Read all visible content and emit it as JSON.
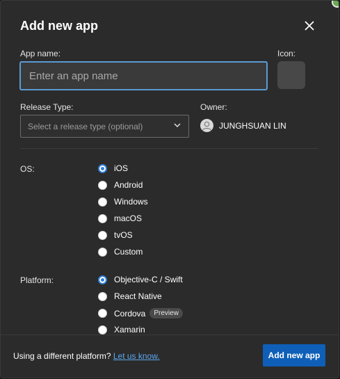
{
  "dialog": {
    "title": "Add new app",
    "close_icon": "close-icon"
  },
  "app_name": {
    "label": "App name:",
    "placeholder": "Enter an app name",
    "value": ""
  },
  "icon": {
    "label": "Icon:"
  },
  "release_type": {
    "label": "Release Type:",
    "placeholder": "Select a release type (optional)",
    "chevron_icon": "chevron-down-icon"
  },
  "owner": {
    "label": "Owner:",
    "name": "JUNGHSUAN LIN",
    "avatar_icon": "user-avatar-icon"
  },
  "os": {
    "label": "OS:",
    "options": [
      {
        "label": "iOS",
        "selected": true
      },
      {
        "label": "Android",
        "selected": false
      },
      {
        "label": "Windows",
        "selected": false
      },
      {
        "label": "macOS",
        "selected": false
      },
      {
        "label": "tvOS",
        "selected": false
      },
      {
        "label": "Custom",
        "selected": false
      }
    ]
  },
  "platform": {
    "label": "Platform:",
    "options": [
      {
        "label": "Objective-C / Swift",
        "selected": true,
        "badge": ""
      },
      {
        "label": "React Native",
        "selected": false,
        "badge": ""
      },
      {
        "label": "Cordova",
        "selected": false,
        "badge": "Preview"
      },
      {
        "label": "Xamarin",
        "selected": false,
        "badge": ""
      }
    ]
  },
  "footer": {
    "text": "Using a different platform? ",
    "link": "Let us know.",
    "primary_button": "Add new app"
  },
  "colors": {
    "accent": "#0f5fb8",
    "focus": "#5b9bd5",
    "link": "#5aa8f0",
    "background": "#2b2b2b"
  }
}
